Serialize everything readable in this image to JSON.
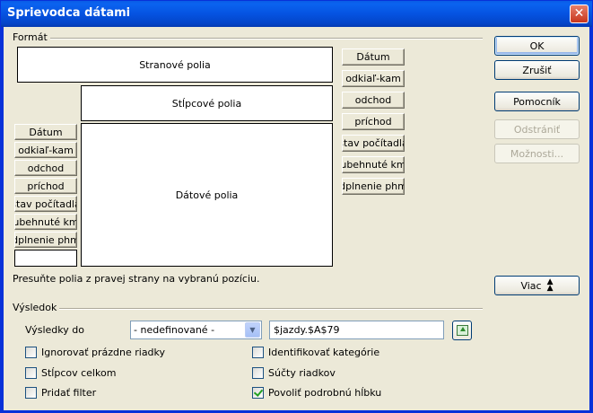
{
  "window": {
    "title": "Sprievodca dátami",
    "close_glyph": "✕"
  },
  "layout_group": {
    "label": "Formát",
    "page_fields_label": "Stranové polia",
    "column_fields_label": "Stĺpcové polia",
    "data_fields_label": "Dátové polia",
    "row_fields": [
      "Dátum",
      "odkiaľ-kam",
      "odchod",
      "príchod",
      "stav počítadla",
      "ubehnuté km",
      "dplnenie phm"
    ],
    "available_fields": [
      "Dátum",
      "odkiaľ-kam",
      "odchod",
      "príchod",
      "stav počítadla",
      "ubehnuté km",
      "dplnenie phm"
    ],
    "hint": "Presuňte polia z pravej strany na vybranú pozíciu."
  },
  "buttons": {
    "ok": "OK",
    "cancel": "Zrušiť",
    "help": "Pomocník",
    "remove": "Odstrániť",
    "options": "Možnosti...",
    "more": "Viac",
    "more_icon": "double-chevron-up-icon"
  },
  "result_group": {
    "label": "Výsledok",
    "results_to_label": "Výsledky do",
    "destination_select": "- nedefinované -",
    "destination_value": "$jazdy.$A$79",
    "pick_icon": "shrink-dialog-icon"
  },
  "options": {
    "ignore_empty_rows": {
      "label": "Ignorovať prázdne riadky",
      "checked": false
    },
    "identify_categories": {
      "label": "Identifikovať kategórie",
      "checked": false
    },
    "total_columns": {
      "label": "Stĺpcov celkom",
      "checked": false
    },
    "total_rows": {
      "label": "Súčty riadkov",
      "checked": false
    },
    "add_filter": {
      "label": "Pridať filter",
      "checked": false
    },
    "enable_drilldown": {
      "label": "Povoliť podrobnú hĺbku",
      "checked": true
    }
  }
}
